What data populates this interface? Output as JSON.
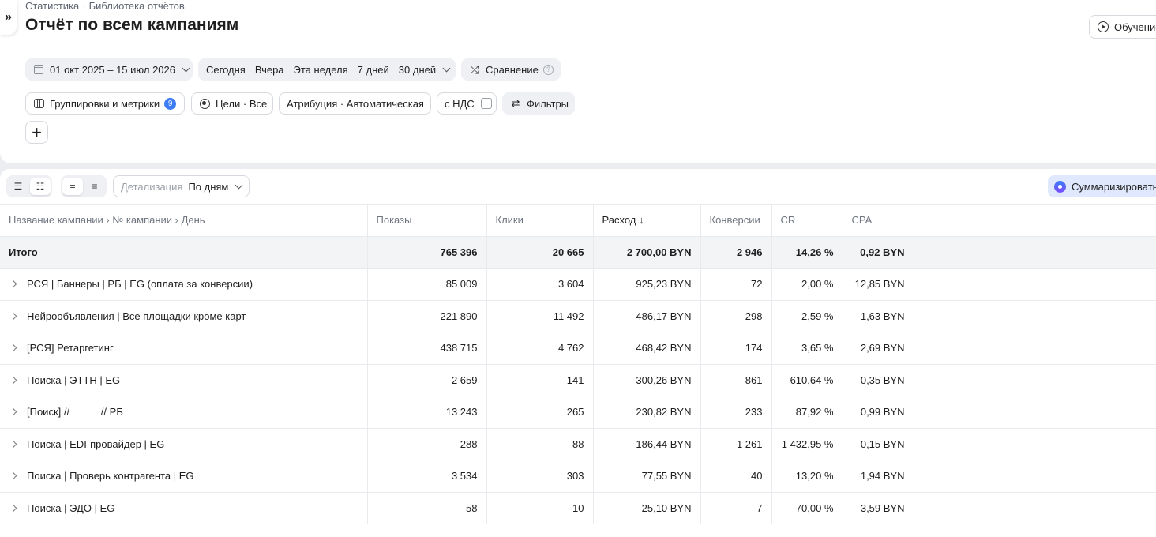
{
  "breadcrumb": [
    "Статистика",
    "Библиотека отчётов"
  ],
  "breadcrumb_sep": "·",
  "title": "Отчёт по всем кампаниям",
  "learn_label": "Обучение",
  "date_range": "01 окт 2025 – 15 июл 2026",
  "quick_periods": [
    "Сегодня",
    "Вчера",
    "Эта неделя",
    "7 дней",
    "30 дней"
  ],
  "compare_label": "Сравнение",
  "help_glyph": "?",
  "groupings_label": "Группировки и метрики",
  "groupings_count": "9",
  "goals_label": "Цели · Все",
  "attribution_label": "Атрибуция · Автоматическая",
  "vat_label": "с НДС",
  "filters_label": "Фильтры",
  "add_glyph": "+",
  "detail_label": "Детализация",
  "detail_value": "По дням",
  "summarize_label": "Суммаризировать",
  "columns": [
    "Название кампании › № кампании › День",
    "Показы",
    "Клики",
    "Расход ↓",
    "Конверсии",
    "CR",
    "CPA"
  ],
  "total": {
    "name": "Итого",
    "shows": "765 396",
    "clicks": "20 665",
    "cost": "2 700,00 BYN",
    "conv": "2 946",
    "cr": "14,26 %",
    "cpa": "0,92 BYN"
  },
  "rows": [
    {
      "name": "РСЯ | Баннеры | РБ | EG (оплата за конверсии)",
      "shows": "85 009",
      "clicks": "3 604",
      "cost": "925,23 BYN",
      "conv": "72",
      "cr": "2,00 %",
      "cpa": "12,85 BYN"
    },
    {
      "name": "Нейрообъявления | Все площадки кроме карт",
      "shows": "221 890",
      "clicks": "11 492",
      "cost": "486,17 BYN",
      "conv": "298",
      "cr": "2,59 %",
      "cpa": "1,63 BYN"
    },
    {
      "name": "[РСЯ] Ретаргетинг",
      "shows": "438 715",
      "clicks": "4 762",
      "cost": "468,42 BYN",
      "conv": "174",
      "cr": "3,65 %",
      "cpa": "2,69 BYN"
    },
    {
      "name": "Поиска | ЭТТН | EG",
      "shows": "2 659",
      "clicks": "141",
      "cost": "300,26 BYN",
      "conv": "861",
      "cr": "610,64 %",
      "cpa": "0,35 BYN"
    },
    {
      "name": "[Поиск] //           // РБ",
      "shows": "13 243",
      "clicks": "265",
      "cost": "230,82 BYN",
      "conv": "233",
      "cr": "87,92 %",
      "cpa": "0,99 BYN"
    },
    {
      "name": "Поиска | EDI-провайдер | EG",
      "shows": "288",
      "clicks": "88",
      "cost": "186,44 BYN",
      "conv": "1 261",
      "cr": "1 432,95 %",
      "cpa": "0,15 BYN"
    },
    {
      "name": "Поиска | Проверь контрагента | EG",
      "shows": "3 534",
      "clicks": "303",
      "cost": "77,55 BYN",
      "conv": "40",
      "cr": "13,20 %",
      "cpa": "1,94 BYN"
    },
    {
      "name": "Поиска | ЭДО | EG",
      "shows": "58",
      "clicks": "10",
      "cost": "25,10 BYN",
      "conv": "7",
      "cr": "70,00 %",
      "cpa": "3,59 BYN"
    }
  ]
}
